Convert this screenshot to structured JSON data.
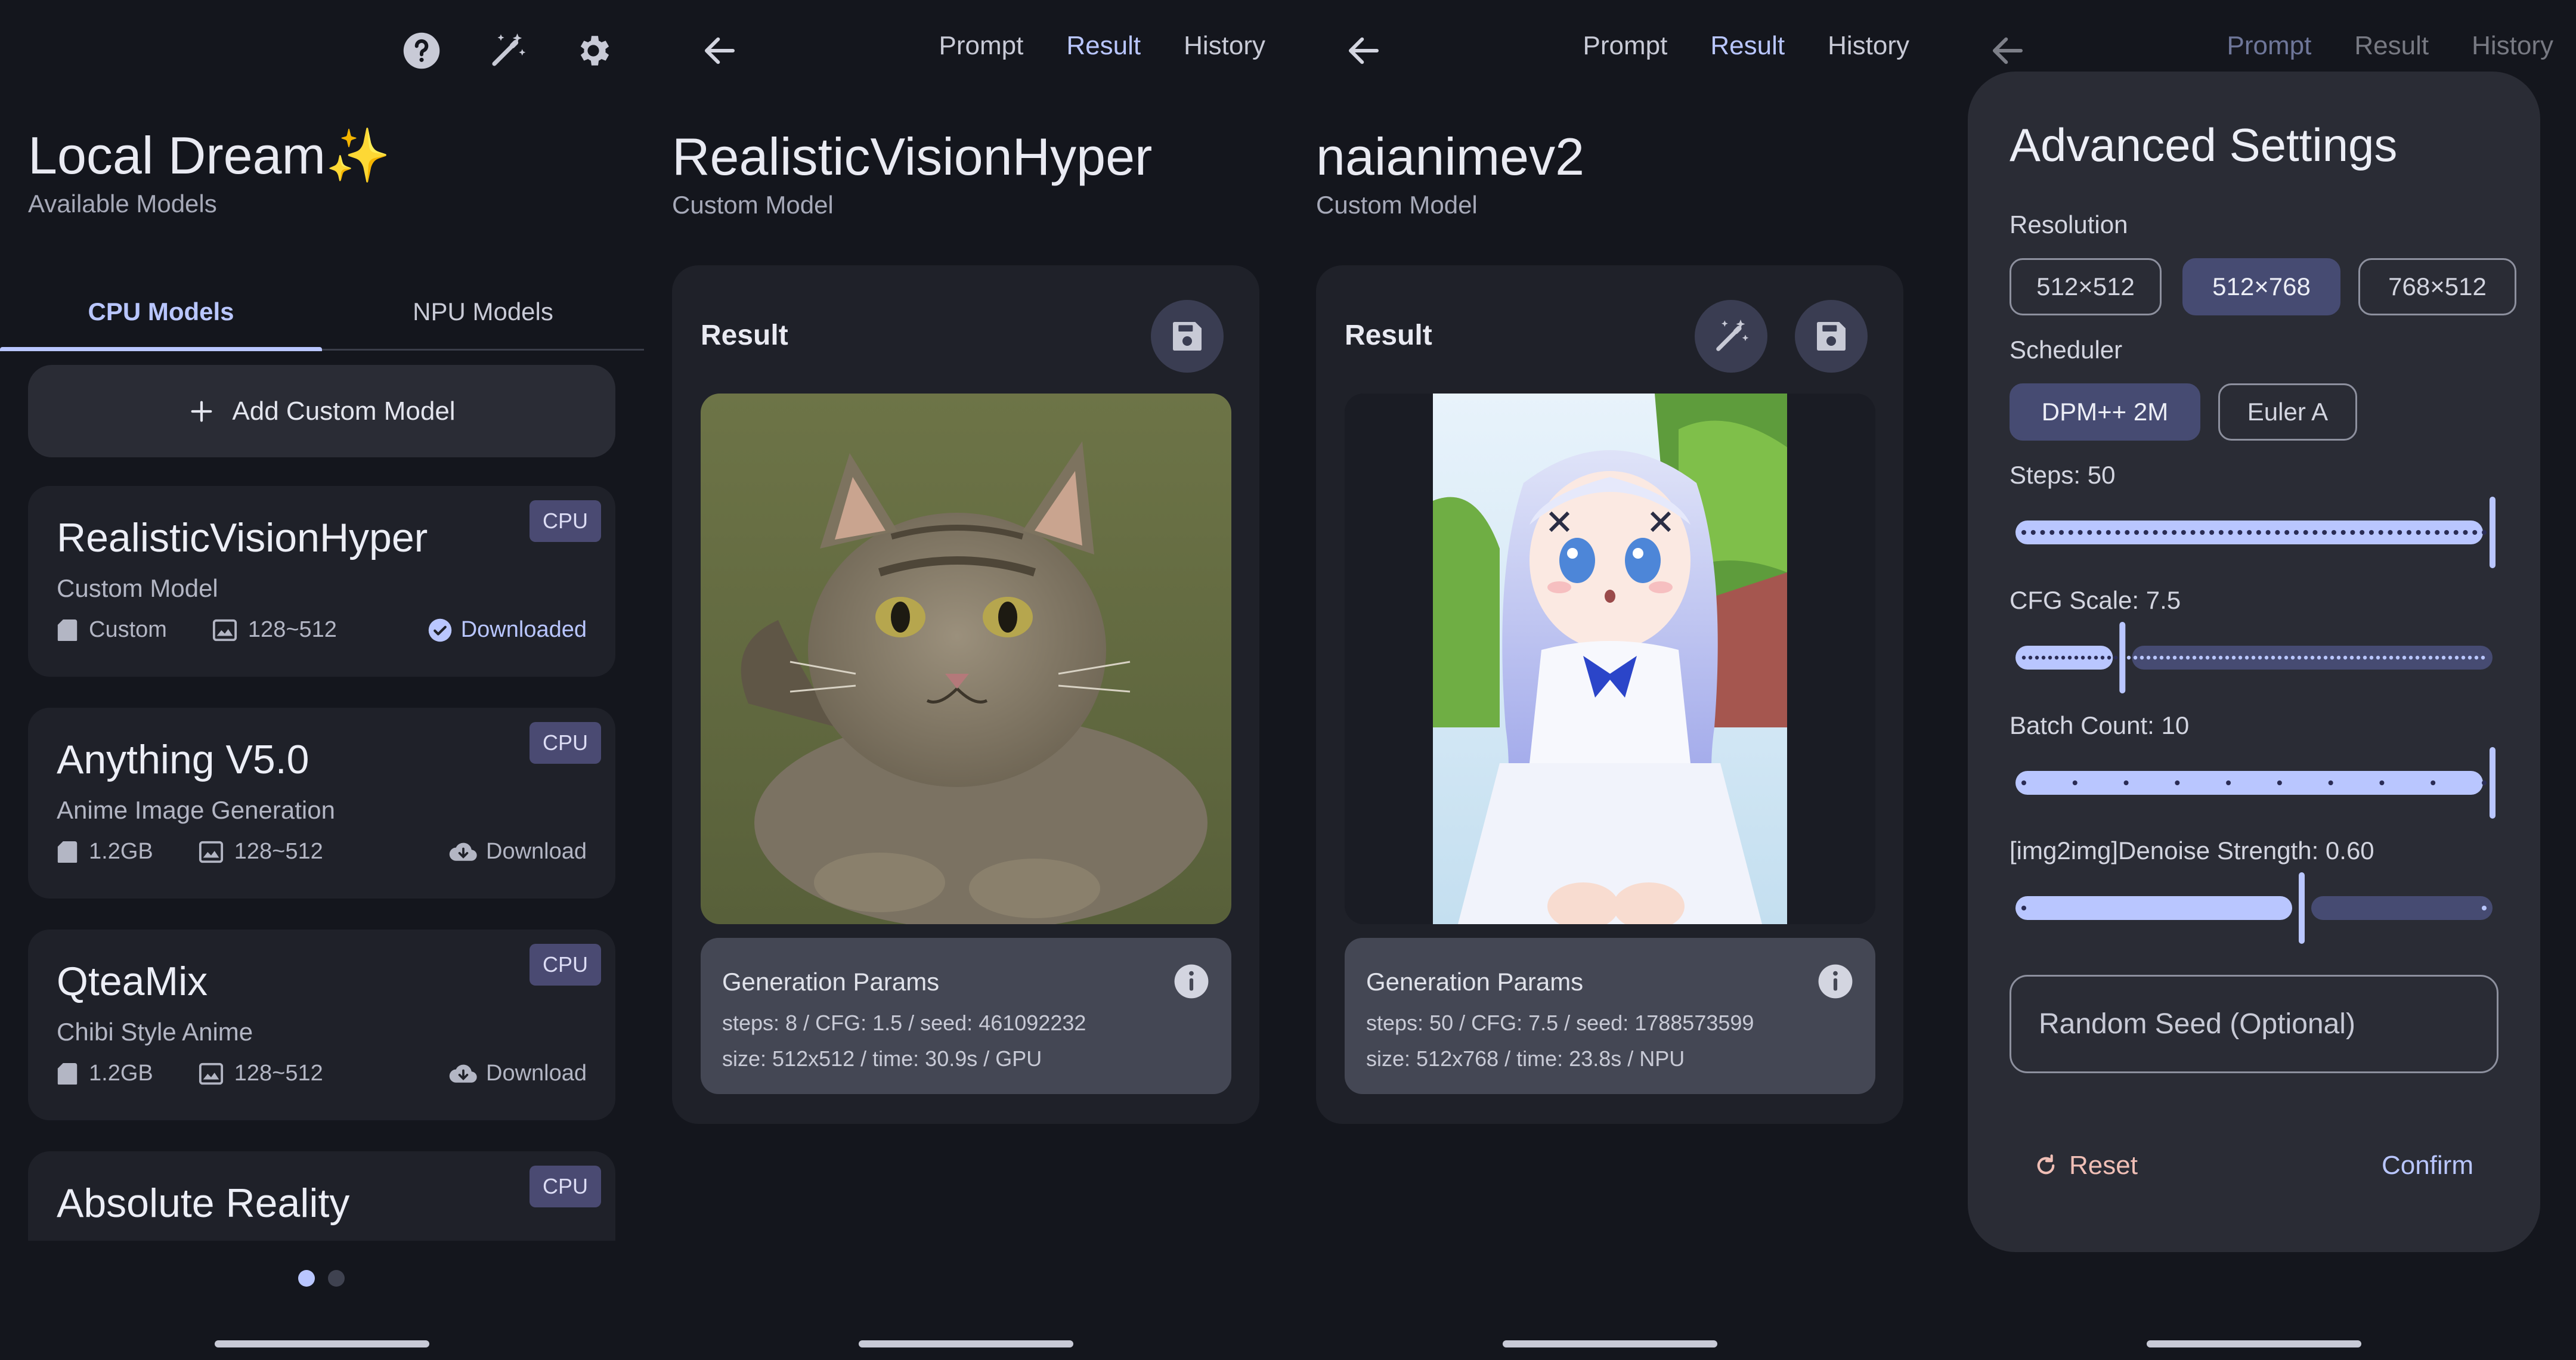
{
  "colors": {
    "accent": "#b9c6ff",
    "background": "#14161d",
    "card": "#1f2129",
    "badge": "#4a4a72",
    "reset": "#f0bfb6"
  },
  "screen1": {
    "icons": [
      "help-icon",
      "magic-wand-icon",
      "gear-icon"
    ],
    "title": "Local Dream✨",
    "subtitle": "Available Models",
    "tabs": [
      {
        "label": "CPU Models",
        "active": true
      },
      {
        "label": "NPU Models",
        "active": false
      }
    ],
    "add_button": "Add Custom Model",
    "models": [
      {
        "name": "RealisticVisionHyper",
        "desc": "Custom Model",
        "badge": "CPU",
        "size": "Custom",
        "res": "128~512",
        "status": "Downloaded"
      },
      {
        "name": "Anything V5.0",
        "desc": "Anime Image Generation",
        "badge": "CPU",
        "size": "1.2GB",
        "res": "128~512",
        "status": "Download"
      },
      {
        "name": "QteaMix",
        "desc": "Chibi Style Anime",
        "badge": "CPU",
        "size": "1.2GB",
        "res": "128~512",
        "status": "Download"
      },
      {
        "name": "Absolute Reality",
        "badge": "CPU"
      }
    ],
    "page_dots": 2,
    "page_active": 1
  },
  "nav_tabs": {
    "prompt": "Prompt",
    "result": "Result",
    "history": "History"
  },
  "screen2": {
    "title": "RealisticVisionHyper",
    "subtitle": "Custom Model",
    "result_label": "Result",
    "params_title": "Generation Params",
    "params_line1": "steps: 8 / CFG: 1.5 / seed: 461092232",
    "params_line2": "size: 512x512 / time: 30.9s / GPU"
  },
  "screen3": {
    "title": "naianimev2",
    "subtitle": "Custom Model",
    "result_label": "Result",
    "params_title": "Generation Params",
    "params_line1": "steps: 50 / CFG: 7.5 / seed: 1788573599",
    "params_line2": "size: 512x768 / time: 23.8s / NPU"
  },
  "screen4": {
    "dialog_title": "Advanced Settings",
    "resolution_label": "Resolution",
    "resolutions": [
      "512×512",
      "512×768",
      "768×512"
    ],
    "resolution_selected": "512×768",
    "scheduler_label": "Scheduler",
    "schedulers": [
      "DPM++ 2M",
      "Euler A"
    ],
    "scheduler_selected": "DPM++ 2M",
    "steps_label": "Steps: 50",
    "steps": {
      "value": 50,
      "min": 1,
      "max": 50
    },
    "cfg_label": "CFG Scale: 7.5",
    "cfg": {
      "value": 7.5,
      "min": 1,
      "max": 30
    },
    "batch_label": "Batch Count: 10",
    "batch": {
      "value": 10,
      "min": 1,
      "max": 10
    },
    "denoise_label": "[img2img]Denoise Strength: 0.60",
    "denoise": {
      "value": 0.6,
      "min": 0,
      "max": 1
    },
    "seed_placeholder": "Random Seed (Optional)",
    "reset_label": "Reset",
    "confirm_label": "Confirm"
  }
}
